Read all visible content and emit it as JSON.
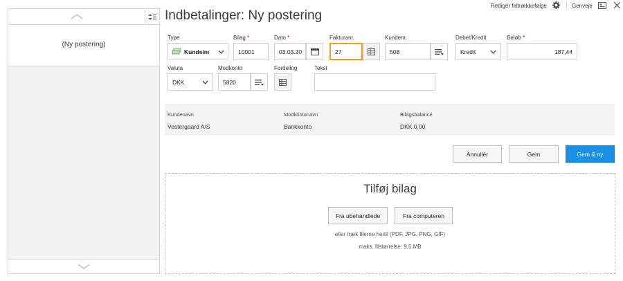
{
  "left_panel": {
    "entry_label": "(Ny postering)"
  },
  "header": {
    "title": "Indbetalinger: Ny postering",
    "edit_order_link": "Redigér feltrækkefølge",
    "shortcuts_link": "Genveje"
  },
  "form": {
    "type": {
      "label": "Type",
      "value": "Kundeind"
    },
    "bilag": {
      "label": "Bilag",
      "required_mark": "*",
      "value": "10001"
    },
    "dato": {
      "label": "Dato",
      "required_mark": "*",
      "value": "03.03.20"
    },
    "fakturanr": {
      "label": "Fakturanr.",
      "value": "27"
    },
    "kundenr": {
      "label": "Kundenr.",
      "value": "508"
    },
    "debet_kredit": {
      "label": "Debet/Kredit",
      "value": "Kredit"
    },
    "belob": {
      "label": "Beløb",
      "required_mark": "*",
      "value": "187,44"
    },
    "valuta": {
      "label": "Valuta",
      "value": "DKK"
    },
    "modkonto": {
      "label": "Modkonto",
      "value": "5820"
    },
    "fordeling": {
      "label": "Fordeling"
    },
    "tekst": {
      "label": "Tekst",
      "value": ""
    }
  },
  "info": {
    "kundenavn": {
      "header": "Kundenavn",
      "value": "Vestergaard A/S"
    },
    "modkontonavn": {
      "header": "Modkontonavn",
      "value": "Bankkonto"
    },
    "bilagsbalance": {
      "header": "Bilagsbalance",
      "value": "DKK 0,00"
    }
  },
  "actions": {
    "cancel": "Annullér",
    "save": "Gem",
    "save_new": "Gem & ny"
  },
  "attachments": {
    "title": "Tilføj bilag",
    "from_unprocessed": "Fra ubehandlede",
    "from_computer": "Fra computeren",
    "drag_hint": "eller træk filerne hertil (PDF, JPG, PNG, GIF)",
    "max_size": "maks. filstørrelse: 9,5 MB"
  },
  "colors": {
    "primary": "#1a8fe3",
    "focus_border": "#e8a319",
    "required": "#d0021b"
  },
  "icons": [
    "chevron-up-icon",
    "sort-icon",
    "chevron-down-icon",
    "gear-icon",
    "keyboard-icon",
    "close-icon",
    "money-icon",
    "calendar-icon",
    "lookup-list-icon",
    "grid-icon"
  ]
}
